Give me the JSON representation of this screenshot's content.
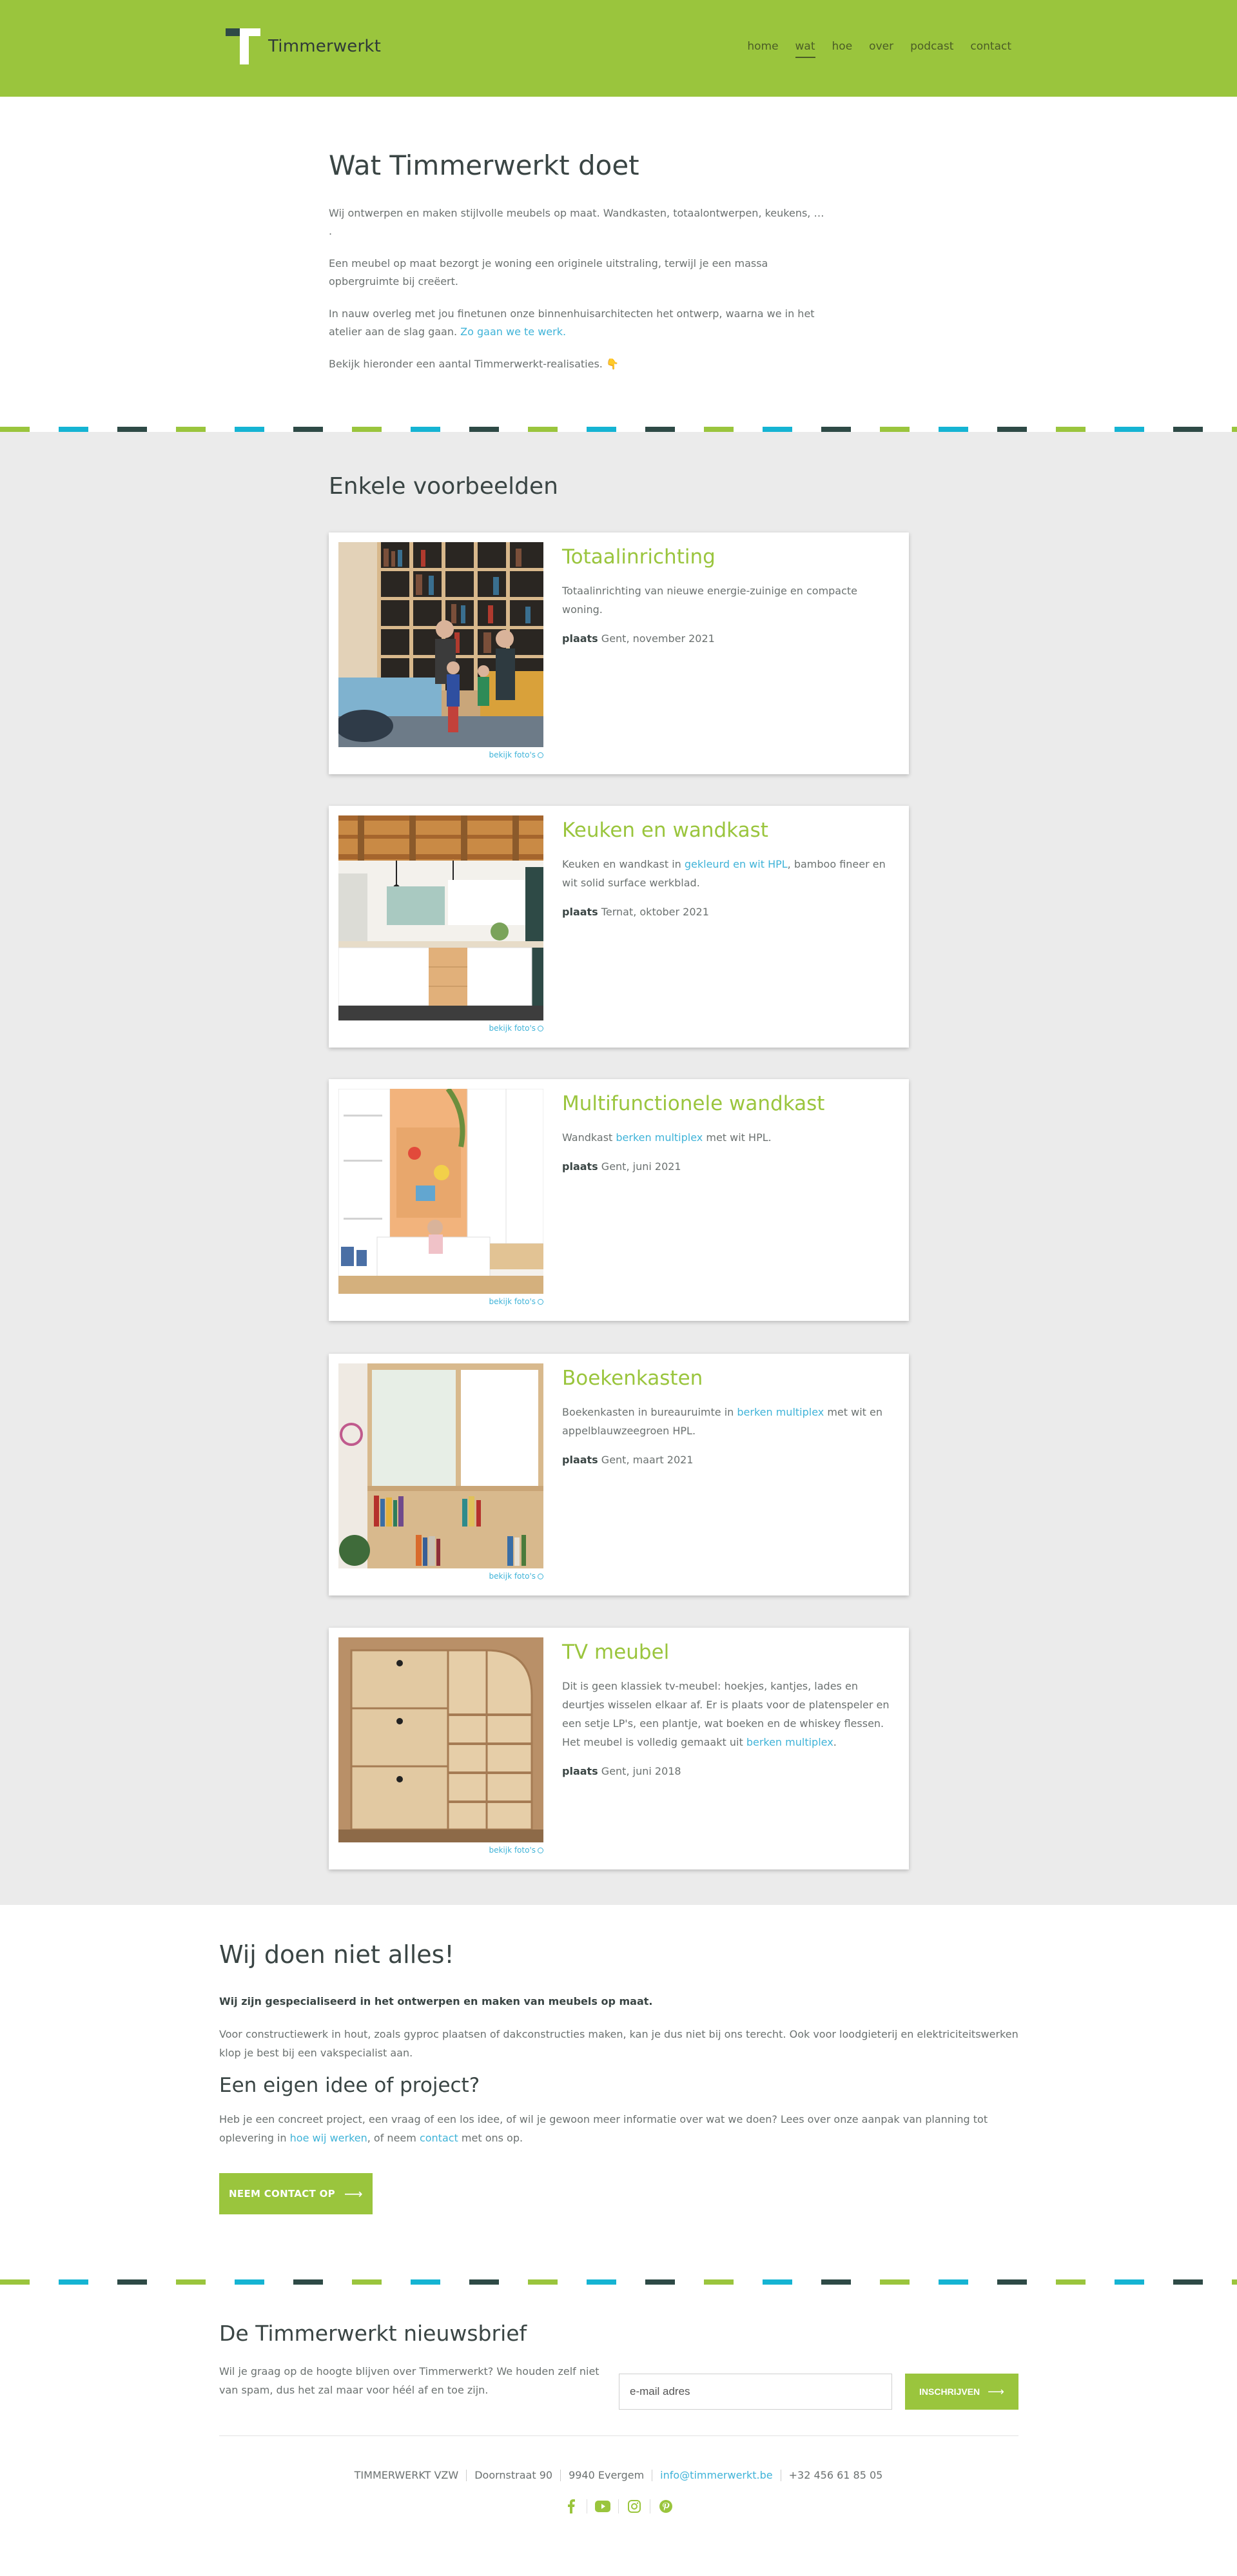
{
  "header": {
    "logo_text": "Timmerwerkt",
    "nav": [
      {
        "label": "home"
      },
      {
        "label": "wat"
      },
      {
        "label": "hoe"
      },
      {
        "label": "over"
      },
      {
        "label": "podcast"
      },
      {
        "label": "contact"
      }
    ],
    "active_nav": "wat"
  },
  "intro": {
    "title": "Wat Timmerwerkt doet",
    "p1": "Wij ontwerpen en maken stijlvolle meubels op maat. Wandkasten, totaalontwerpen, keukens, … .",
    "p2": "Een meubel op maat bezorgt je woning een originele uitstraling, terwijl je een massa opbergruimte bij creëert.",
    "p3_text": "In nauw overleg met jou finetunen onze binnenhuisarchitecten het ontwerp, waarna we in het atelier aan de slag gaan.",
    "p3_link": "Zo gaan we te werk.",
    "p4": "Bekijk hieronder een aantal Timmerwerkt-realisaties. 👇"
  },
  "examples": {
    "title": "Enkele voorbeelden",
    "photo_link": "bekijk foto's",
    "place_label": "plaats",
    "items": [
      {
        "title": "Totaalinrichting",
        "desc": "Totaalinrichting van nieuwe energie-zuinige en compacte woning.",
        "place": "Gent, november 2021"
      },
      {
        "title": "Keuken en wandkast",
        "desc_before": "Keuken en wandkast in",
        "desc_link": "gekleurd en wit HPL",
        "desc_after": ", bamboo fineer en wit solid surface werkblad.",
        "place": "Ternat, oktober 2021"
      },
      {
        "title": "Multifunctionele wandkast",
        "desc_before": "Wandkast",
        "desc_link": "berken multiplex",
        "desc_after": "met wit HPL.",
        "place": "Gent, juni 2021"
      },
      {
        "title": "Boekenkasten",
        "desc_before": "Boekenkasten in bureauruimte in",
        "desc_link": "berken multiplex",
        "desc_after": "met wit en appelblauwzeegroen HPL.",
        "place": "Gent, maart 2021"
      },
      {
        "title": "TV meubel",
        "desc_before": "Dit is geen klassiek tv-meubel: hoekjes, kantjes, lades en deurtjes wisselen elkaar af. Er is plaats voor de platenspeler en een setje LP's, een plantje, wat boeken en de whiskey flessen. Het meubel is volledig gemaakt uit",
        "desc_link": "berken multiplex",
        "desc_after": ".",
        "place": "Gent, juni 2018"
      }
    ]
  },
  "not_all": {
    "title": "Wij doen niet alles!",
    "strong": "Wij zijn gespecialiseerd in het ontwerpen en maken van meubels op maat.",
    "p1": "Voor constructiewerk in hout, zoals gyproc plaatsen of dakconstructies maken, kan je dus niet bij ons terecht. Ook voor loodgieterij en elektriciteitswerken klop je best bij een vakspecialist aan.",
    "subtitle": "Een eigen idee of project?",
    "p2_before": "Heb je een concreet project, een vraag of een los idee, of wil je gewoon meer informatie over wat we doen? Lees over onze aanpak van planning tot oplevering in",
    "p2_link1": "hoe wij werken",
    "p2_mid": ", of neem",
    "p2_link2": "contact",
    "p2_after": "met ons op.",
    "button": "NEEM CONTACT OP"
  },
  "newsletter": {
    "title": "De Timmerwerkt nieuwsbrief",
    "text": "Wil je graag op de hoogte blijven over Timmerwerkt? We houden zelf niet van spam, dus het zal maar voor héél af en toe zijn.",
    "placeholder": "e-mail adres",
    "button": "INSCHRIJVEN"
  },
  "footer": {
    "company": "TIMMERWERKT VZW",
    "street": "Doornstraat 90",
    "city": "9940 Evergem",
    "email": "info@timmerwerkt.be",
    "phone": "+32 456 61 85 05",
    "social_icons": [
      "facebook-icon",
      "youtube-icon",
      "instagram-icon",
      "pinterest-icon"
    ]
  },
  "colors": {
    "brand_green": "#9ac53d",
    "dark_teal": "#2e4a46",
    "link_blue": "#3fb3d8",
    "cyan": "#15b4d3",
    "grey_bg": "#ebebeb"
  }
}
